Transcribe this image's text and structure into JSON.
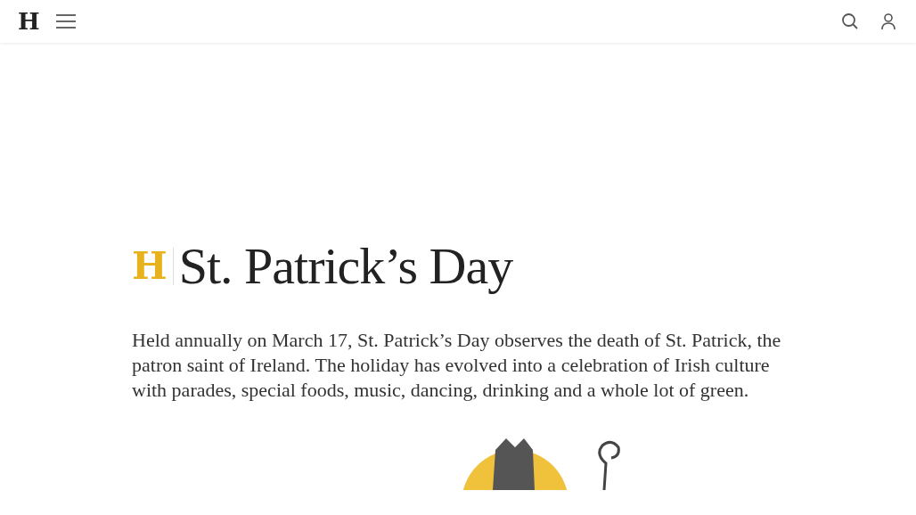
{
  "header": {
    "logo": "H"
  },
  "topic": {
    "badge": "H",
    "title": "St. Patrick’s Day",
    "description": "Held annually on March 17, St. Patrick’s Day observes the death of St. Patrick, the patron saint of Ireland. The holiday has evolved into a celebration of Irish culture with parades, special foods, music, dancing, drinking and a whole lot of green."
  }
}
